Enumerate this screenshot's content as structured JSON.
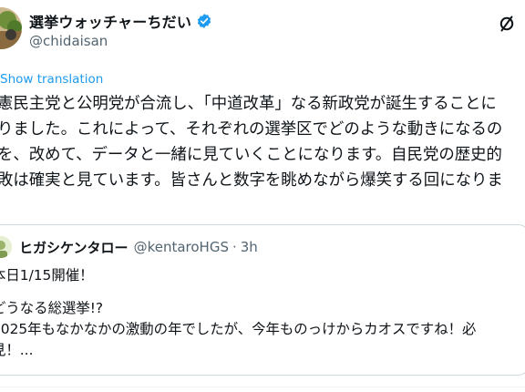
{
  "author": {
    "display_name": "選挙ウォッチャーちだい",
    "handle": "@chidaisan",
    "verified_icon": "verified-badge-icon",
    "accent_color": "#1d9bf0"
  },
  "actions": {
    "grok_icon": "grok-slash-circle-icon"
  },
  "tweet": {
    "show_translation": "Show translation",
    "lines": [
      "憲民主党と公明党が合流し、「中道改革」なる新政党が誕生することに",
      "りました。これによって、それぞれの選挙区でどのような動きになるの",
      "を、改めて、データと一緒に見ていくことになります。自民党の歴史的",
      "敗は確実と見ています。皆さんと数字を眺めながら爆笑する回になりま"
    ]
  },
  "quote": {
    "display_name": "ヒガシケンタロー",
    "handle": "@kentaroHGS",
    "separator": "·",
    "time": "3h",
    "line1": "本日1/15開催！",
    "line2": "どうなる総選挙!?",
    "line3": "2025年もなかなかの激動の年でしたが、今年ものっけからカオスですね！必",
    "line4": "見！..."
  }
}
